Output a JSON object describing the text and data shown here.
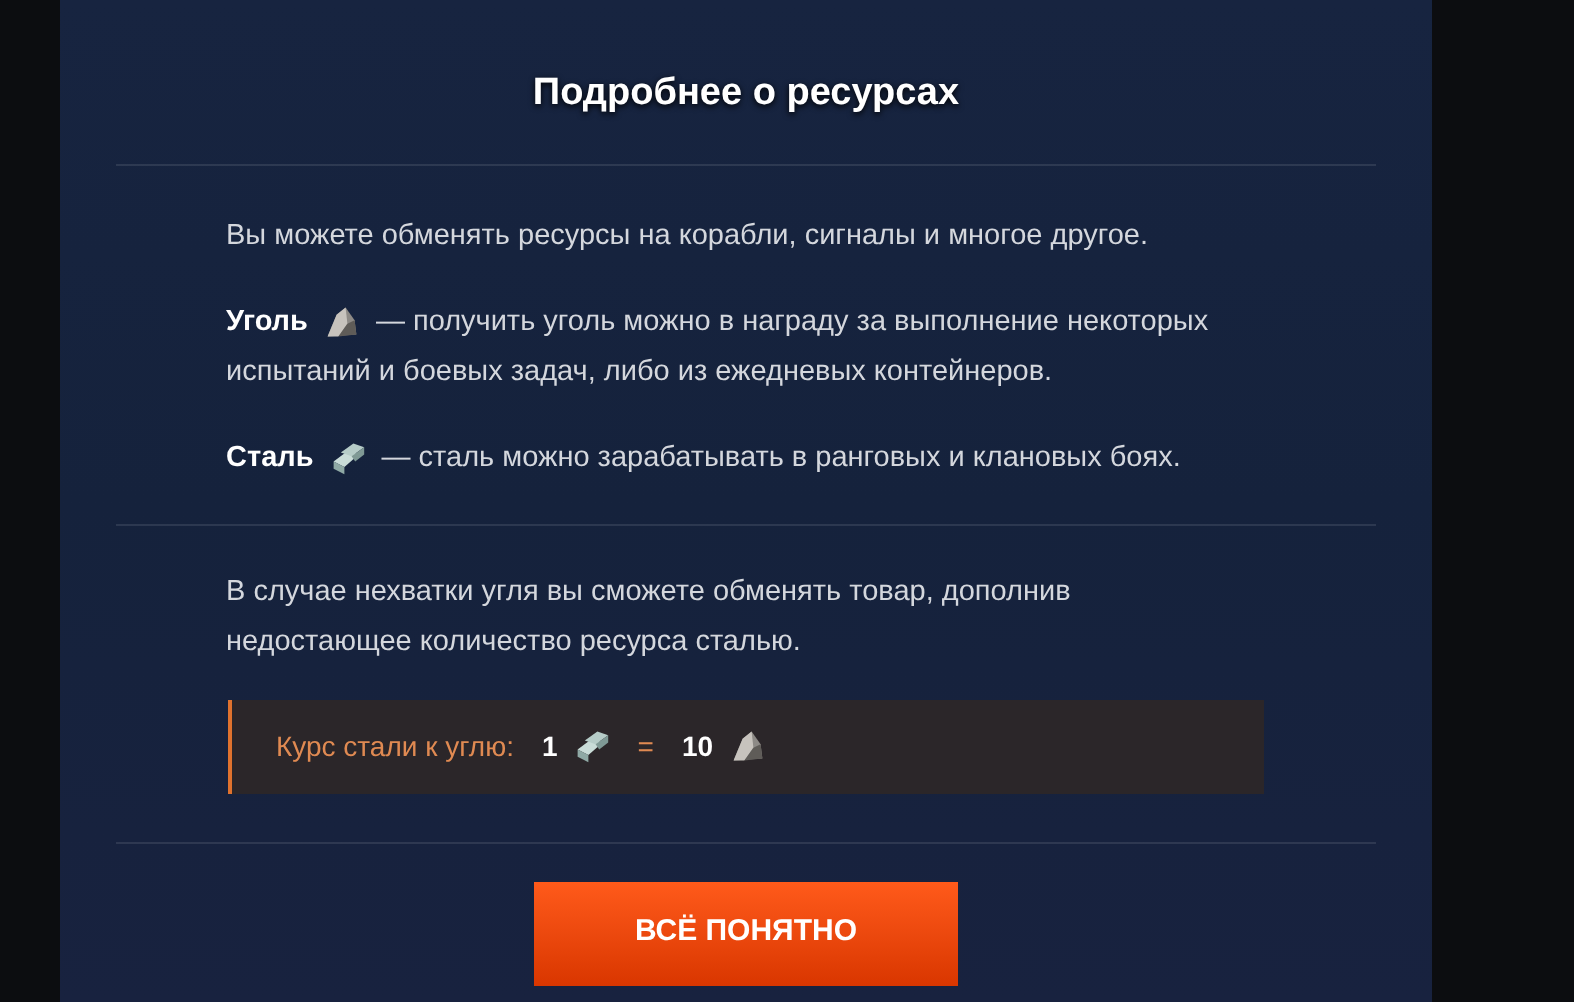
{
  "dialog": {
    "title": "Подробнее о ресурсах",
    "intro": "Вы можете обменять ресурсы на корабли, сигналы и многое другое.",
    "resources": [
      {
        "kind": "coal",
        "name": "Уголь",
        "description_lines": [
          "—  получить уголь можно в награду за выполнение некоторых",
          "испытаний и боевых задач, либо из ежедневых контейнеров."
        ]
      },
      {
        "kind": "steel",
        "name": "Сталь",
        "description_lines": [
          "—  сталь можно зарабатывать в ранговых и клановых боях."
        ]
      }
    ],
    "note": "В случае нехватки угля вы сможете обменять товар, дополнив недостающее количество ресурса сталью.",
    "exchange_rate": {
      "label": "Курс стали к углю:",
      "from": {
        "amount": "1",
        "kind": "steel"
      },
      "equals": "=",
      "to": {
        "amount": "10",
        "kind": "coal"
      }
    },
    "button": "ВСЁ ПОНЯТНО"
  }
}
